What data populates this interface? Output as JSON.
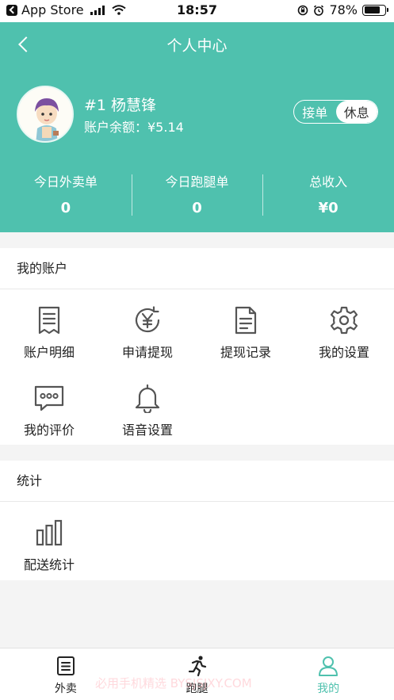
{
  "status_bar": {
    "back_app": "App Store",
    "time": "18:57",
    "battery": "78%",
    "battery_level": 0.78
  },
  "nav": {
    "title": "个人中心"
  },
  "profile": {
    "name": "#1 杨慧锋",
    "balance": "账户余额：¥5.14",
    "toggle": {
      "on_label": "接单",
      "off_label": "休息",
      "selected": "休息"
    }
  },
  "stats": [
    {
      "label": "今日外卖单",
      "value": "0"
    },
    {
      "label": "今日跑腿单",
      "value": "0"
    },
    {
      "label": "总收入",
      "value": "¥0"
    }
  ],
  "account": {
    "title": "我的账户",
    "items": [
      {
        "label": "账户明细",
        "icon": "document-list-icon"
      },
      {
        "label": "申请提现",
        "icon": "yen-refresh-icon"
      },
      {
        "label": "提现记录",
        "icon": "file-text-icon"
      },
      {
        "label": "我的设置",
        "icon": "gear-icon"
      },
      {
        "label": "我的评价",
        "icon": "chat-bubble-icon"
      },
      {
        "label": "语音设置",
        "icon": "bell-icon"
      }
    ]
  },
  "statistics": {
    "title": "统计",
    "items": [
      {
        "label": "配送统计",
        "icon": "bar-chart-icon"
      }
    ]
  },
  "tabbar": {
    "items": [
      {
        "label": "外卖",
        "icon": "list-icon",
        "active": false
      },
      {
        "label": "跑腿",
        "icon": "runner-icon",
        "active": false
      },
      {
        "label": "我的",
        "icon": "user-icon",
        "active": true
      }
    ]
  },
  "watermark": "必用手机精选 BYSJSJXY.COM",
  "colors": {
    "accent": "#4fc1ae",
    "page_background": "#f4f4f4",
    "icon_gray": "#555555"
  }
}
